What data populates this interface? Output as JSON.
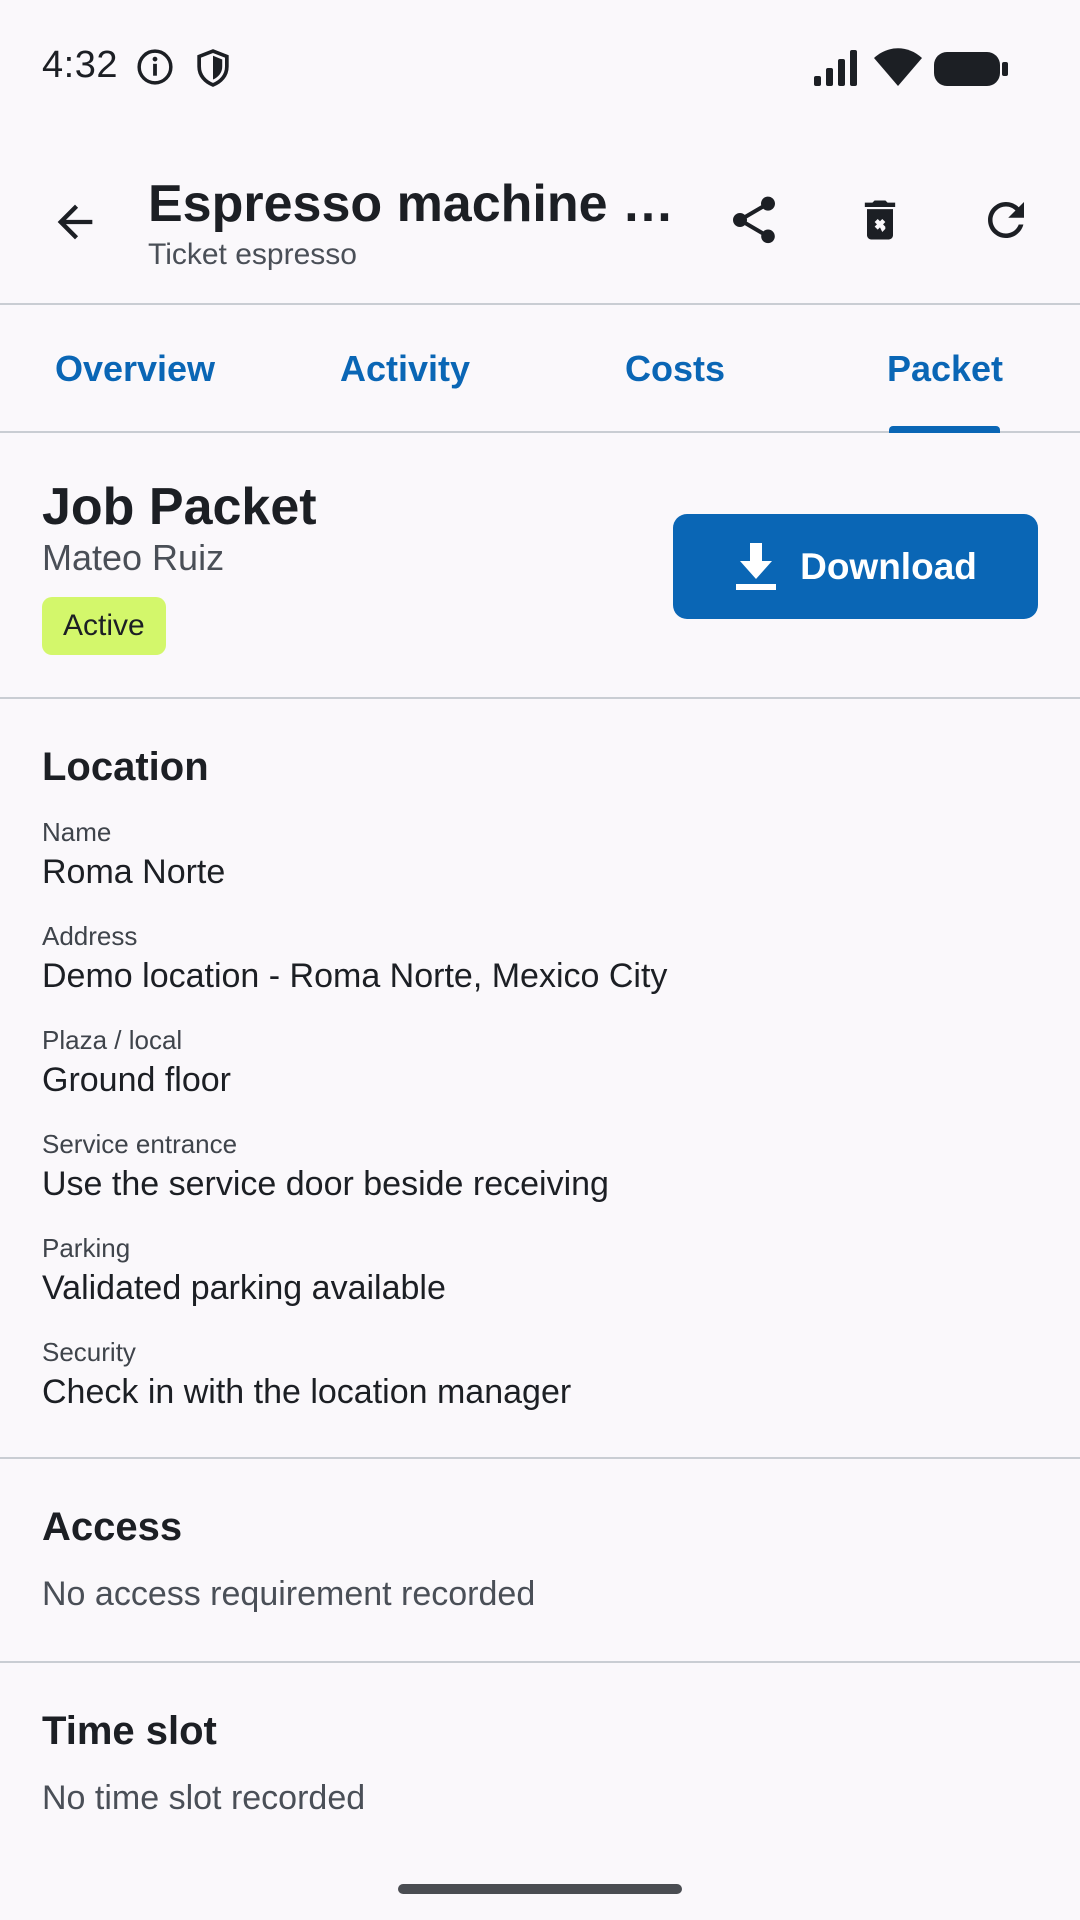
{
  "status_bar": {
    "time": "4:32",
    "icons": [
      "info-icon",
      "shield-icon",
      "signal-icon",
      "wifi-icon",
      "battery-icon"
    ]
  },
  "app_bar": {
    "title": "Espresso machine lo…",
    "subtitle": "Ticket espresso",
    "icons": [
      "back-arrow-icon",
      "share-icon",
      "delete-icon",
      "refresh-icon"
    ]
  },
  "tabs": [
    {
      "label": "Overview"
    },
    {
      "label": "Activity"
    },
    {
      "label": "Costs"
    },
    {
      "label": "Packet",
      "selected": true
    }
  ],
  "packet": {
    "title": "Job Packet",
    "person": "Mateo Ruiz",
    "status": "Active",
    "download_label": "Download"
  },
  "location": {
    "title": "Location",
    "fields": [
      {
        "label": "Name",
        "value": "Roma Norte"
      },
      {
        "label": "Address",
        "value": "Demo location - Roma Norte, Mexico City"
      },
      {
        "label": "Plaza / local",
        "value": "Ground floor"
      },
      {
        "label": "Service entrance",
        "value": "Use the service door beside receiving"
      },
      {
        "label": "Parking",
        "value": "Validated parking available"
      },
      {
        "label": "Security",
        "value": "Check in with the location manager"
      }
    ]
  },
  "access": {
    "title": "Access",
    "note": "No access requirement recorded"
  },
  "time_slot": {
    "title": "Time slot",
    "note": "No time slot recorded"
  },
  "colors": {
    "accent": "#0a66b5",
    "badge": "#d3f76b",
    "background": "#faf8fb",
    "divider": "#c9cdd3"
  }
}
